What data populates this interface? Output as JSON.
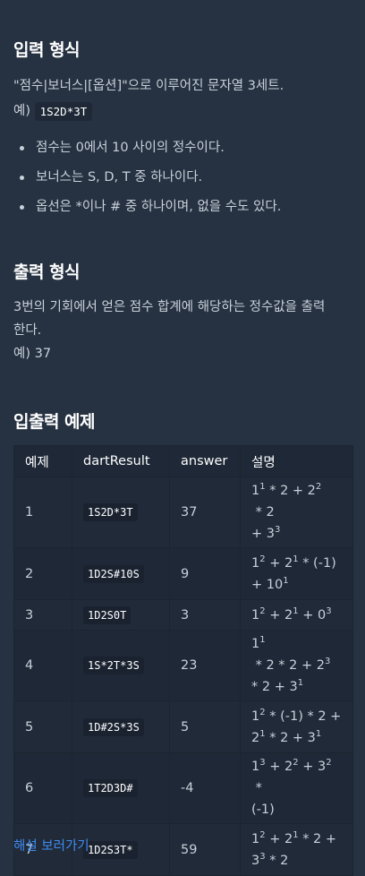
{
  "input_section": {
    "title": "입력 형식",
    "desc": "\"점수|보너스|[옵션]\"으로 이루어진 문자열 3세트.",
    "example_label": "예)",
    "example_code": "1S2D*3T",
    "bullets": [
      "점수는 0에서 10 사이의 정수이다.",
      "보너스는 S, D, T 중 하나이다.",
      "옵선은 *이나 # 중 하나이며, 없을 수도 있다."
    ]
  },
  "output_section": {
    "title": "출력 형식",
    "desc_line1": "3번의 기회에서 얻은 점수 합계에 해당하는 정수값을 출력",
    "desc_line2": "한다.",
    "example": "예) 37"
  },
  "examples_section": {
    "title": "입출력 예제",
    "headers": [
      "예제",
      "dartResult",
      "answer",
      "설명"
    ],
    "rows": [
      {
        "num": "1",
        "dart": "1S2D*3T",
        "answer": "37",
        "explanation": [
          [
            "1",
            "1",
            " * 2 + "
          ],
          [
            "2",
            "2",
            " * 2"
          ],
          [
            "br"
          ],
          [
            "+ 3",
            "3",
            ""
          ]
        ]
      },
      {
        "num": "2",
        "dart": "1D2S#10S",
        "answer": "9",
        "explanation": [
          [
            "1",
            "2",
            " + "
          ],
          [
            "2",
            "1",
            " * (-1)"
          ],
          [
            "br"
          ],
          [
            "+ 10",
            "1",
            ""
          ]
        ]
      },
      {
        "num": "3",
        "dart": "1D2S0T",
        "answer": "3",
        "explanation": [
          [
            "1",
            "2",
            " + "
          ],
          [
            "2",
            "1",
            " + "
          ],
          [
            "0",
            "3",
            ""
          ]
        ]
      },
      {
        "num": "4",
        "dart": "1S*2T*3S",
        "answer": "23",
        "explanation": [
          [
            "1",
            "1",
            " * 2 * 2 + "
          ],
          [
            "2",
            "3",
            ""
          ],
          [
            "br"
          ],
          [
            "* 2 + 3",
            "1",
            ""
          ]
        ]
      },
      {
        "num": "5",
        "dart": "1D#2S*3S",
        "answer": "5",
        "explanation": [
          [
            "1",
            "2",
            " * (-1) * 2 +"
          ],
          [
            "br"
          ],
          [
            "2",
            "1",
            " * 2 + "
          ],
          [
            "3",
            "1",
            ""
          ]
        ]
      },
      {
        "num": "6",
        "dart": "1T2D3D#",
        "answer": "-4",
        "explanation": [
          [
            "1",
            "3",
            " + "
          ],
          [
            "2",
            "2",
            " + "
          ],
          [
            "3",
            "2",
            " *"
          ],
          [
            "br"
          ],
          [
            "(-1)",
            "",
            ""
          ]
        ]
      },
      {
        "num": "7",
        "dart": "1D2S3T*",
        "answer": "59",
        "explanation": [
          [
            "1",
            "2",
            " + "
          ],
          [
            "2",
            "1",
            " * 2 +"
          ],
          [
            "br"
          ],
          [
            "3",
            "3",
            " * 2"
          ]
        ]
      }
    ]
  },
  "solution_link": "해설 보러가기"
}
